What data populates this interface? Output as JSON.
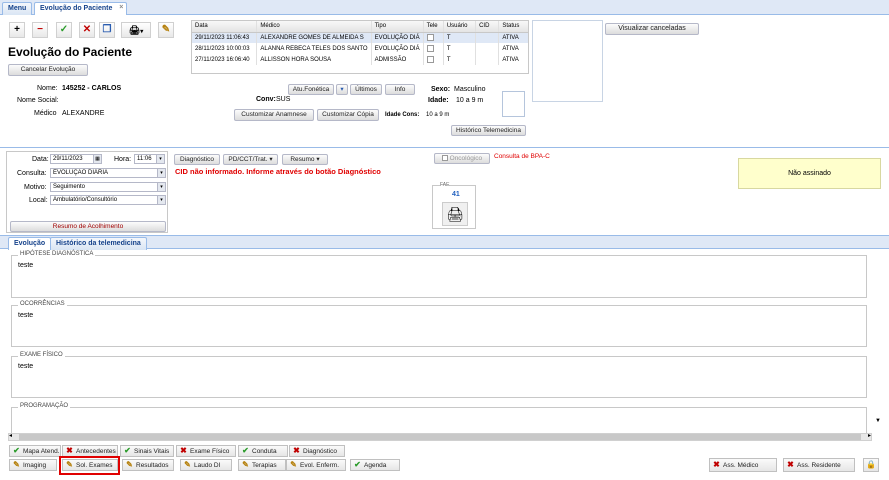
{
  "tabs": {
    "menu": "Menu",
    "evolucao": "Evolução do Paciente"
  },
  "toolbar": {
    "add": "+",
    "remove": "−",
    "confirm": "✓",
    "cancel": "✕",
    "copy": "❐",
    "print": "🖨",
    "edit": "✎"
  },
  "header": {
    "title": "Evolução do Paciente",
    "cancel_label": "Cancelar Evolução"
  },
  "history_table": {
    "columns": [
      "Data",
      "Médico",
      "Tipo",
      "Tele",
      "Usuário",
      "CID",
      "Status"
    ],
    "rows": [
      {
        "data": "29/11/2023 11:06:43",
        "medico": "ALEXANDRE GOMES DE ALMEIDA S",
        "tipo": "EVOLUÇÃO DIÁ",
        "usuario": "T",
        "cid": "",
        "status": "ATIVA"
      },
      {
        "data": "28/11/2023 10:00:03",
        "medico": "ALANNA REBECA TELES DOS SANTO",
        "tipo": "EVOLUÇÃO DIÁ",
        "usuario": "T",
        "cid": "",
        "status": "ATIVA"
      },
      {
        "data": "27/11/2023 16:06:40",
        "medico": "ALLISSON HORA SOUSA",
        "tipo": "ADMISSÃO",
        "usuario": "T",
        "cid": "",
        "status": "ATIVA"
      }
    ]
  },
  "visualizar_canceladas": "Visualizar canceladas",
  "patient": {
    "nome_label": "Nome:",
    "nome": "145252 - CARLOS",
    "nome_social_label": "Nome Social:",
    "medico_label": "Médico",
    "medico": "ALEXANDRE",
    "conv_label": "Conv:",
    "conv": "SUS",
    "sexo_label": "Sexo:",
    "sexo": "Masculino",
    "idade_label": "Idade:",
    "idade": "10 a 9 m",
    "idade_cons_label": "Idade Cons:",
    "idade_cons": "10 a 9 m"
  },
  "actions": {
    "atu_fonetica": "Atu.Fonética",
    "ultimos": "Últimos",
    "info": "Info",
    "customizar_anamnese": "Customizar Anamnese",
    "customizar_copia": "Customizar Cópia",
    "historico_telemedicina": "Histórico Telemedicina"
  },
  "form": {
    "data_label": "Data:",
    "data": "29/11/2023",
    "hora_label": "Hora:",
    "hora": "11:06",
    "consulta_label": "Consulta:",
    "consulta": "EVOLUÇÃO DIÁRIA",
    "motivo_label": "Motivo:",
    "motivo": "Seguimento",
    "local_label": "Local:",
    "local": "Ambulatório/Consultório",
    "resumo_acolhimento": "Resumo de Acolhimento"
  },
  "diag_bar": {
    "diagnostico": "Diagnóstico",
    "pd": "PD/CCT/Trat.",
    "resumo": "Resumo",
    "oncologico": "Oncológico",
    "consulta_bpa": "Consulta de BPA-C",
    "cid_warning": "CID não informado. Informe através do botão Diagnóstico"
  },
  "fae": {
    "label": "FAE",
    "count": "41"
  },
  "assinatura": "Não assinado",
  "sub_tabs": {
    "evolucao": "Evolução",
    "historico_tele": "Histórico da telemedicina"
  },
  "sections": [
    {
      "legend": "HIPÓTESE DIAGNÓSTICA",
      "text": "teste"
    },
    {
      "legend": "OCORRÊNCIAS",
      "text": "teste"
    },
    {
      "legend": "EXAME FÍSICO",
      "text": "teste"
    },
    {
      "legend": "PROGRAMAÇÃO",
      "text": ""
    }
  ],
  "bottom_row1": [
    {
      "label": "Mapa Atend.",
      "icon": "check"
    },
    {
      "label": "Antecedentes",
      "icon": "x"
    },
    {
      "label": "Sinais Vitais",
      "icon": "check"
    },
    {
      "label": "Exame Físico",
      "icon": "x"
    },
    {
      "label": "Conduta",
      "icon": "check"
    },
    {
      "label": "Diagnóstico",
      "icon": "x"
    }
  ],
  "bottom_row2": [
    {
      "label": "Imaging",
      "icon": "pencil"
    },
    {
      "label": "Sol. Exames",
      "icon": "pencil"
    },
    {
      "label": "Resultados",
      "icon": "pencil"
    },
    {
      "label": "Laudo DI",
      "icon": "pencil"
    },
    {
      "label": "Terapias",
      "icon": "pencil"
    },
    {
      "label": "Evol. Enferm.",
      "icon": "pencil"
    },
    {
      "label": "Agenda",
      "icon": "check"
    }
  ],
  "signatures": {
    "ass_medico": "Ass. Médico",
    "ass_residente": "Ass. Residente"
  },
  "colors": {
    "highlight": "#e00000",
    "warning": "#e00000",
    "note_bg": "#ffffcc",
    "tab_blue": "#15428b"
  }
}
